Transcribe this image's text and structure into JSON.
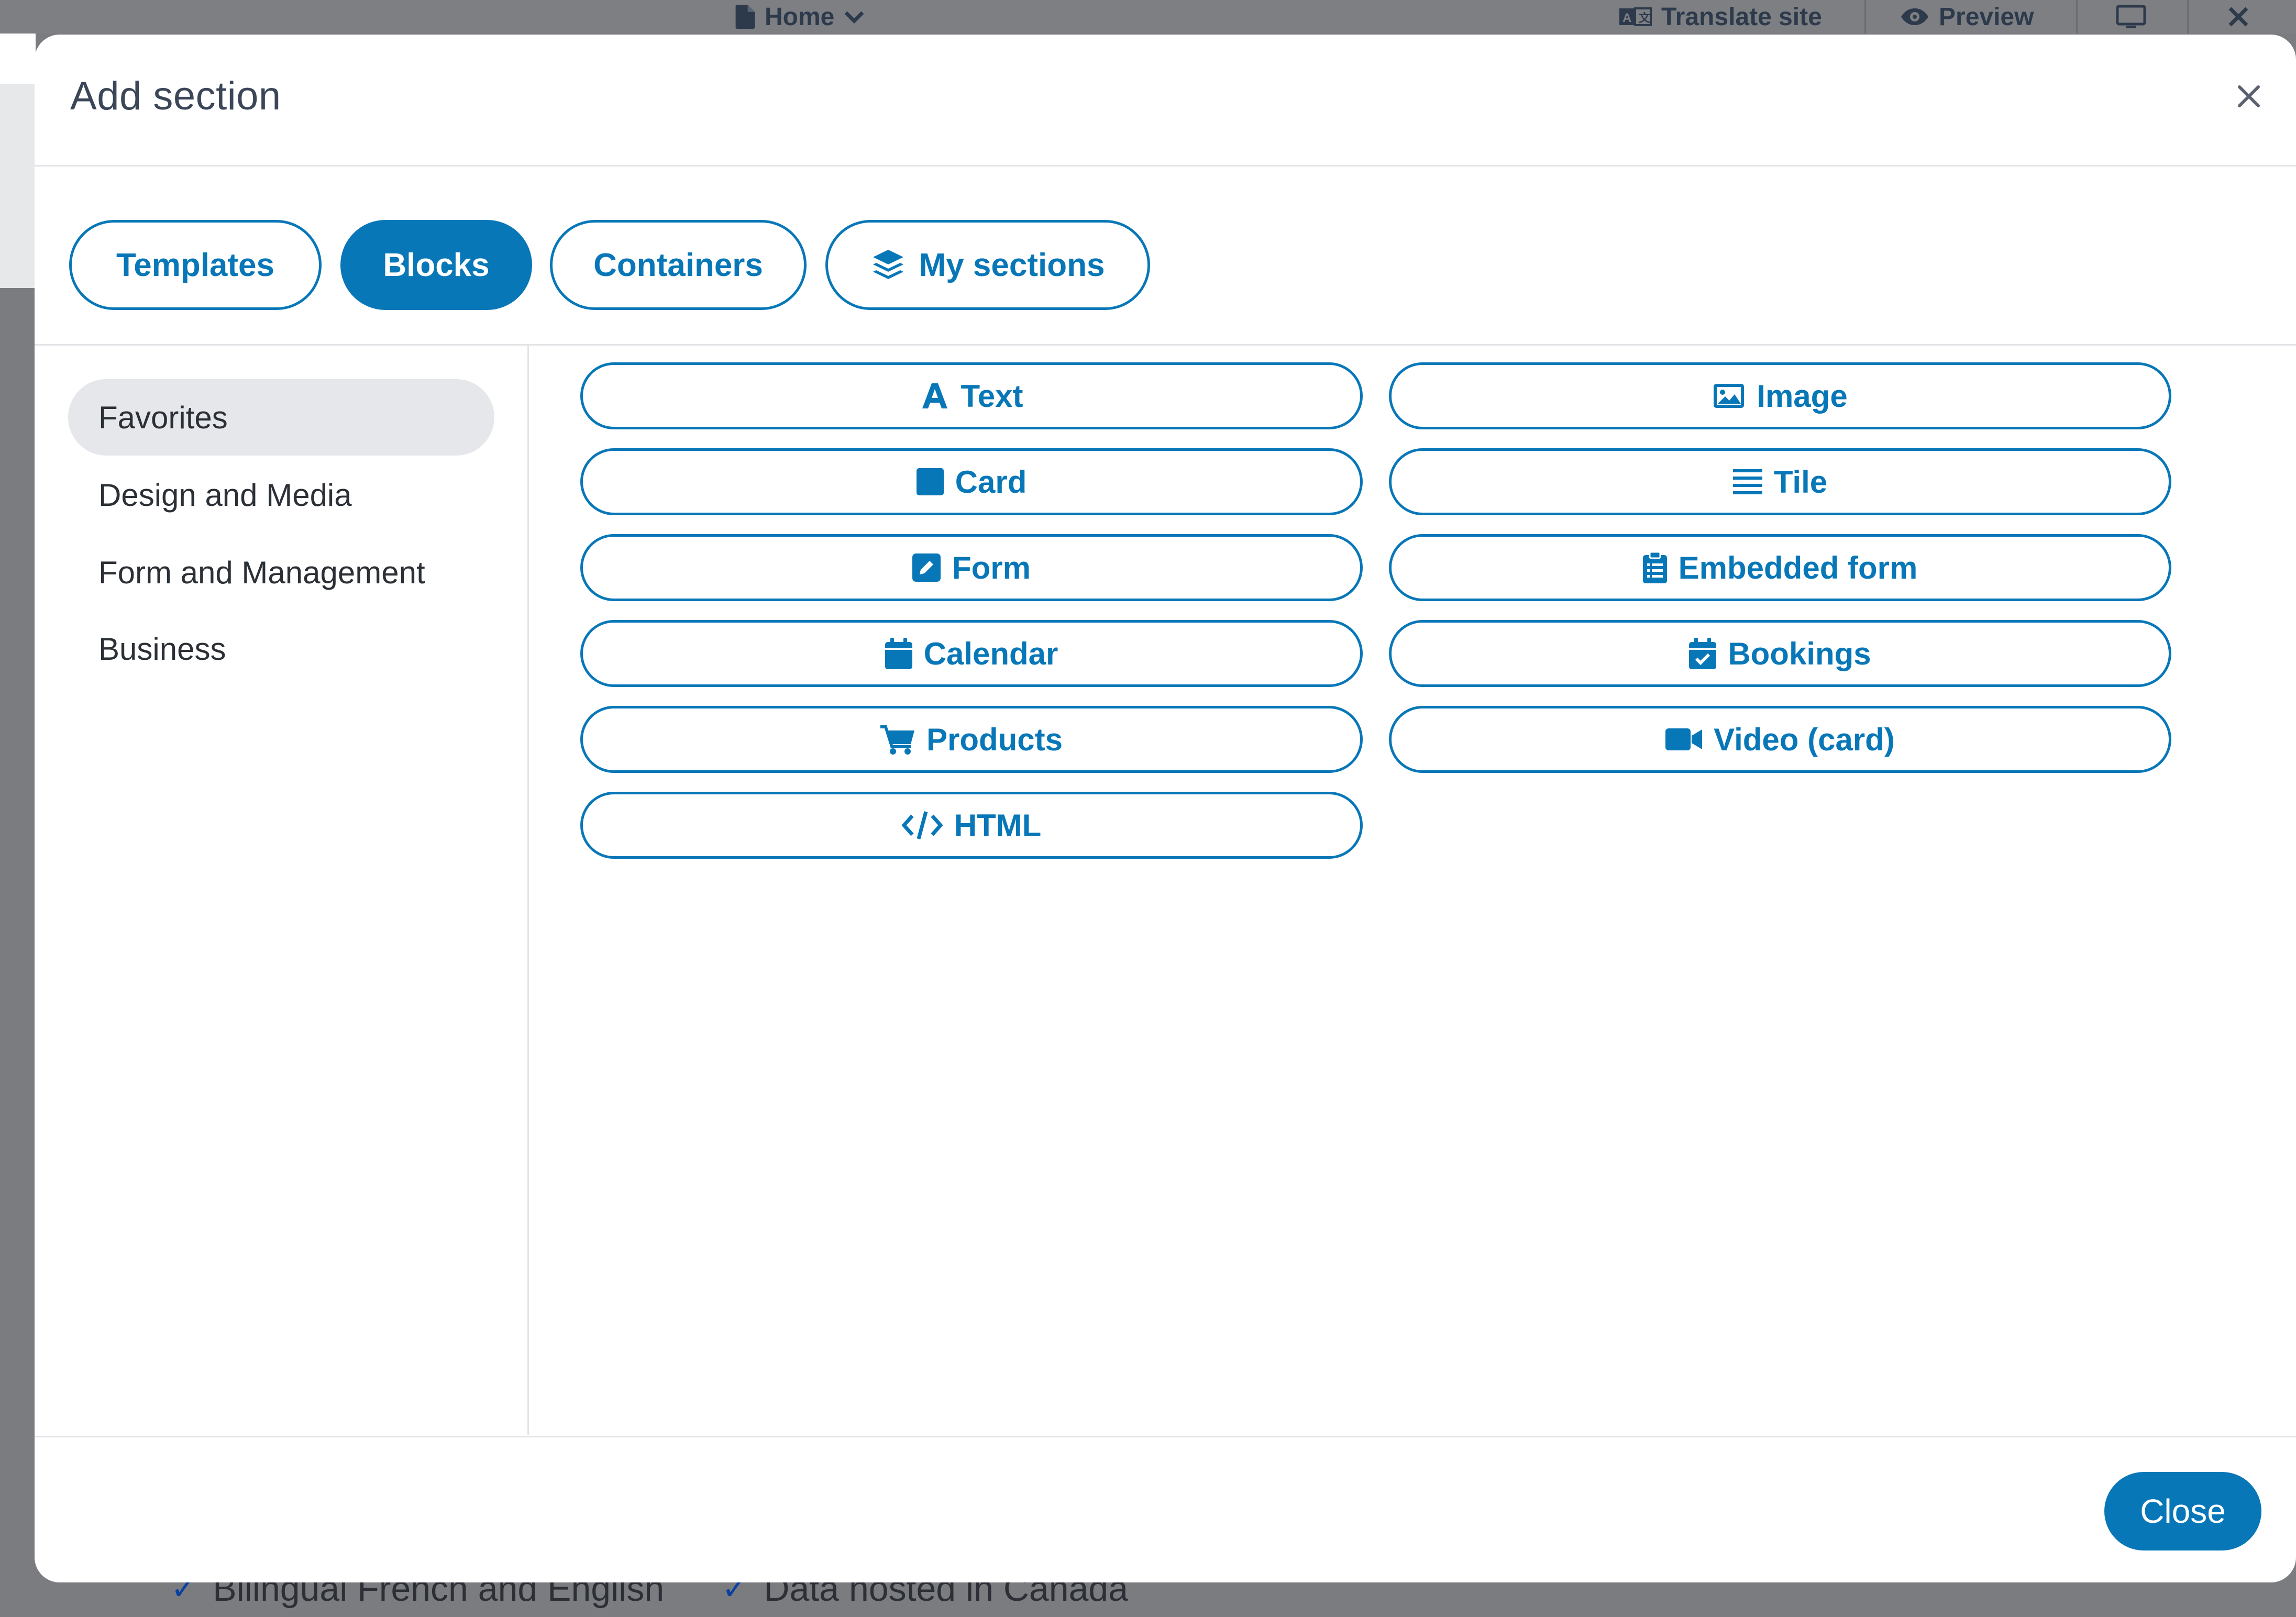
{
  "background": {
    "topbar": {
      "page_selector": "Home",
      "translate_label": "Translate site",
      "preview_label": "Preview"
    },
    "footer_features": [
      "Bilingual French and English",
      "Data hosted in Canada"
    ]
  },
  "modal": {
    "title": "Add section",
    "tabs": [
      {
        "label": "Templates",
        "active": false
      },
      {
        "label": "Blocks",
        "active": true
      },
      {
        "label": "Containers",
        "active": false
      },
      {
        "label": "My sections",
        "active": false,
        "icon": "layers-icon"
      }
    ],
    "sidebar": {
      "items": [
        {
          "label": "Favorites",
          "active": true
        },
        {
          "label": "Design and Media",
          "active": false
        },
        {
          "label": "Form and Management",
          "active": false
        },
        {
          "label": "Business",
          "active": false
        }
      ]
    },
    "blocks": [
      {
        "label": "Text",
        "icon": "font-icon"
      },
      {
        "label": "Image",
        "icon": "image-icon"
      },
      {
        "label": "Card",
        "icon": "square-icon"
      },
      {
        "label": "Tile",
        "icon": "list-lines-icon"
      },
      {
        "label": "Form",
        "icon": "edit-icon"
      },
      {
        "label": "Embedded form",
        "icon": "clipboard-list-icon"
      },
      {
        "label": "Calendar",
        "icon": "calendar-icon"
      },
      {
        "label": "Bookings",
        "icon": "calendar-check-icon"
      },
      {
        "label": "Products",
        "icon": "cart-icon"
      },
      {
        "label": "Video (card)",
        "icon": "video-icon"
      },
      {
        "label": "HTML",
        "icon": "code-icon"
      }
    ],
    "footer": {
      "close_label": "Close"
    }
  },
  "colors": {
    "accent": "#0877b8",
    "overlay": "#7a7c80",
    "sidebar_active_bg": "#e6e7ea",
    "text_dark": "#2b2f36"
  }
}
